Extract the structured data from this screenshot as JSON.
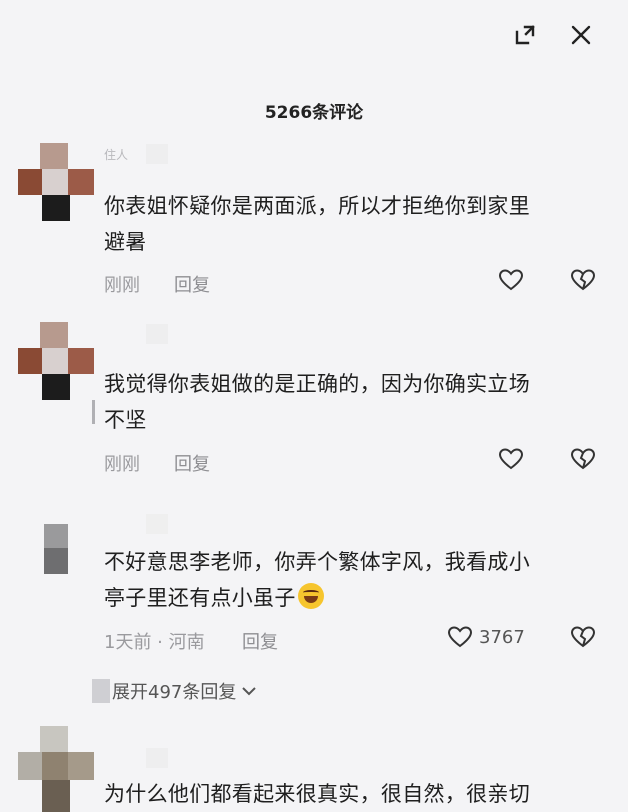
{
  "header": {
    "comment_count": "5266条评论"
  },
  "comments": [
    {
      "username": "住人",
      "text_line1": "你表姐怀疑你是两面派，所以才拒绝你到家里",
      "text_line2": "避暑",
      "time": "刚刚",
      "reply_label": "回复"
    },
    {
      "text_line1": "我觉得你表姐做的是正确的，因为你确实立场",
      "text_line2": "不坚",
      "time": "刚刚",
      "reply_label": "回复"
    },
    {
      "text_line1": "不好意思李老师，你弄个繁体字风，我看成小",
      "text_line2": "亭子里还有点小虽子",
      "time": "1天前 · 河南",
      "reply_label": "回复",
      "likes": "3767",
      "expand_replies": "展开497条回复"
    },
    {
      "text_line1": "为什么他们都看起来很真实，很自然，很亲切"
    }
  ],
  "colors": {
    "background": "#f4f4f6",
    "text": "#1f1f1f",
    "meta": "#9a9a9e"
  },
  "icons": {
    "expand": "expand-icon",
    "close": "close-icon",
    "like": "heart-icon",
    "dislike": "broken-heart-icon",
    "chevron": "chevron-down-icon"
  }
}
